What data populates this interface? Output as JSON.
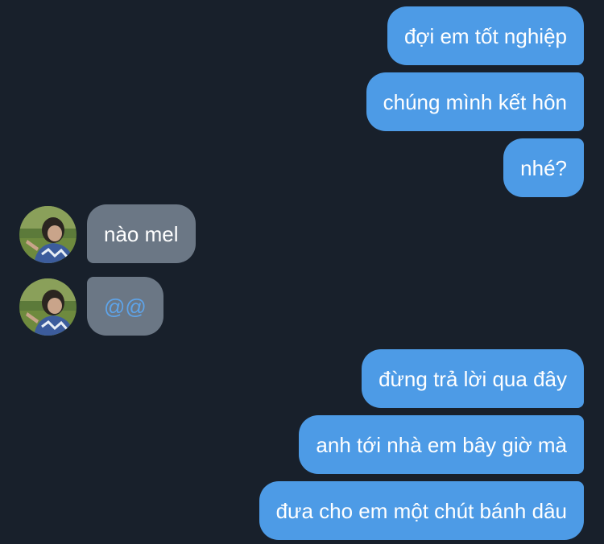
{
  "messages": [
    {
      "from": "me",
      "text": "đợi em tốt nghiệp"
    },
    {
      "from": "me",
      "text": "chúng mình kết hôn"
    },
    {
      "from": "me",
      "text": "nhé?"
    },
    {
      "from": "them",
      "text": "nào mel"
    },
    {
      "from": "them",
      "text": "@@"
    },
    {
      "from": "me",
      "text": "đừng trả lời qua đây"
    },
    {
      "from": "me",
      "text": "anh tới nhà em bây giờ mà"
    },
    {
      "from": "me",
      "text": "đưa cho em một chút bánh dâu"
    }
  ],
  "colors": {
    "background": "#18202b",
    "outgoing_bubble": "#4d9be6",
    "incoming_bubble": "#6b7785",
    "link_text": "#5ea4ea"
  },
  "icons": {
    "contact_avatar": "profile-photo-avatar"
  }
}
